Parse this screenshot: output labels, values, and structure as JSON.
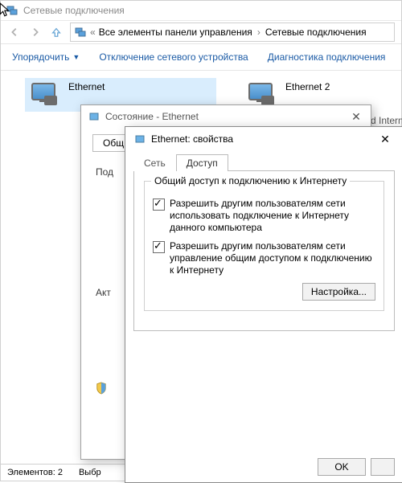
{
  "window": {
    "title": "Сетевые подключения",
    "breadcrumb": {
      "root": "Все элементы панели управления",
      "leaf": "Сетевые подключения"
    }
  },
  "commands": {
    "organize": "Упорядочить",
    "disable": "Отключение сетевого устройства",
    "diagnose": "Диагностика подключения"
  },
  "adapters": {
    "a": {
      "name": "Ethernet"
    },
    "b": {
      "name": "Ethernet 2",
      "below_text": "d Internet"
    }
  },
  "status_dialog": {
    "title": "Состояние - Ethernet",
    "tab_general": "Общ",
    "f_conn": "Под",
    "f_act": "Акт"
  },
  "props": {
    "title": "Ethernet: свойства",
    "tab_net": "Сеть",
    "tab_access": "Доступ",
    "group": "Общий доступ к подключению к Интернету",
    "chk1": "Разрешить другим пользователям сети использовать подключение к Интернету данного компьютера",
    "chk2": "Разрешить другим пользователям сети управление общим доступом к подключению к Интернету",
    "settings_btn": "Настройка..."
  },
  "status_bar": {
    "count": "Элементов: 2",
    "selected": "Выбр"
  },
  "ok": "OK"
}
